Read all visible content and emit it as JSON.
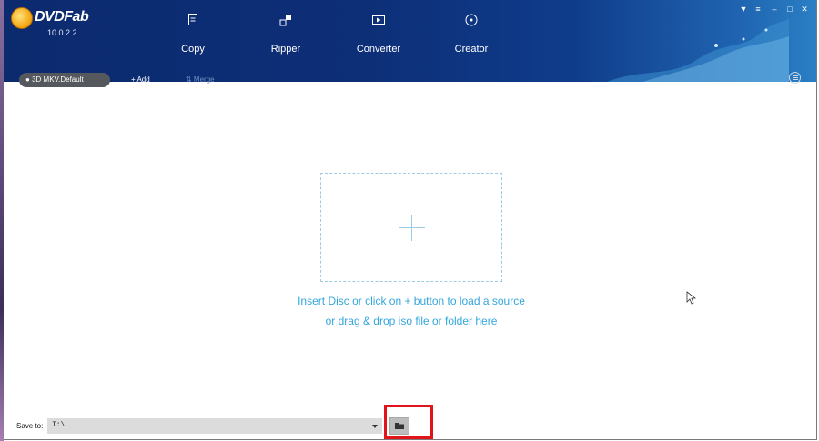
{
  "app": {
    "logo_text": "DVDFab",
    "version": "10.0.2.2"
  },
  "nav": {
    "items": [
      {
        "label": "Copy",
        "icon": "copy-icon"
      },
      {
        "label": "Ripper",
        "icon": "ripper-icon"
      },
      {
        "label": "Converter",
        "icon": "converter-icon"
      },
      {
        "label": "Creator",
        "icon": "creator-icon"
      }
    ]
  },
  "window_controls": [
    "dropdown-icon",
    "settings-icon",
    "minimize-icon",
    "maximize-icon",
    "close-icon"
  ],
  "toolbar": {
    "profile_label": "3D MKV.Default",
    "add_label": "+ Add",
    "merge_label": "⇅ Merge"
  },
  "drop_zone": {
    "line1": "Insert Disc or click on + button to load a source",
    "line2": "or drag & drop iso file or folder here"
  },
  "footer": {
    "save_label": "Save to:",
    "save_path": "I:\\"
  },
  "colors": {
    "header": "#0d2f78",
    "accent": "#33a6dc",
    "highlight": "#e3131b"
  }
}
